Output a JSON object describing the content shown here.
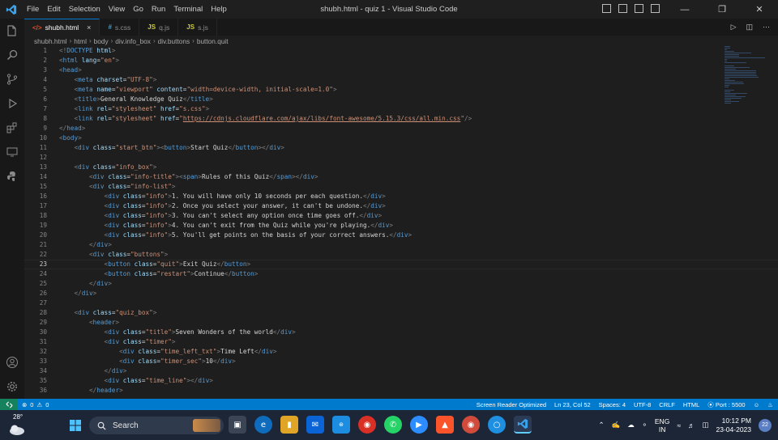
{
  "menu": [
    "File",
    "Edit",
    "Selection",
    "View",
    "Go",
    "Run",
    "Terminal",
    "Help"
  ],
  "window_title": "shubh.html - quiz 1 - Visual Studio Code",
  "tabs": [
    {
      "icon": "</>",
      "label": "shubh.html",
      "close": "×",
      "active": true,
      "icon_color": "#e44d26"
    },
    {
      "icon": "#",
      "label": "s.css",
      "active": false,
      "icon_color": "#519aba"
    },
    {
      "icon": "JS",
      "label": "q.js",
      "active": false,
      "icon_color": "#cbcb41"
    },
    {
      "icon": "JS",
      "label": "s.js",
      "active": false,
      "icon_color": "#cbcb41"
    }
  ],
  "breadcrumb": [
    "shubh.html",
    "html",
    "body",
    "div.info_box",
    "div.buttons",
    "button.quit"
  ],
  "line_numbers": [
    "1",
    "2",
    "3",
    "4",
    "5",
    "6",
    "7",
    "8",
    "9",
    "10",
    "11",
    "12",
    "13",
    "14",
    "15",
    "16",
    "17",
    "18",
    "19",
    "20",
    "21",
    "22",
    "23",
    "24",
    "25",
    "26",
    "27",
    "28",
    "29",
    "30",
    "31",
    "32",
    "33",
    "34",
    "35",
    "36"
  ],
  "current_line": 23,
  "code": [
    [
      [
        "br",
        "<!"
      ],
      [
        "tg",
        "DOCTYPE"
      ],
      [
        "at",
        " html"
      ],
      [
        "br",
        ">"
      ]
    ],
    [
      [
        "br",
        "<"
      ],
      [
        "tg",
        "html"
      ],
      [
        "at",
        " lang"
      ],
      [
        "t",
        "="
      ],
      [
        "st",
        "\"en\""
      ],
      [
        "br",
        ">"
      ]
    ],
    [
      [
        "br",
        "<"
      ],
      [
        "tg",
        "head"
      ],
      [
        "br",
        ">"
      ]
    ],
    [
      [
        "t",
        "    "
      ],
      [
        "br",
        "<"
      ],
      [
        "tg",
        "meta"
      ],
      [
        "at",
        " charset"
      ],
      [
        "t",
        "="
      ],
      [
        "st",
        "\"UTF-8\""
      ],
      [
        "br",
        ">"
      ]
    ],
    [
      [
        "t",
        "    "
      ],
      [
        "br",
        "<"
      ],
      [
        "tg",
        "meta"
      ],
      [
        "at",
        " name"
      ],
      [
        "t",
        "="
      ],
      [
        "st",
        "\"viewport\""
      ],
      [
        "at",
        " content"
      ],
      [
        "t",
        "="
      ],
      [
        "st",
        "\"width=device-width, initial-scale=1.0\""
      ],
      [
        "br",
        ">"
      ]
    ],
    [
      [
        "t",
        "    "
      ],
      [
        "br",
        "<"
      ],
      [
        "tg",
        "title"
      ],
      [
        "br",
        ">"
      ],
      [
        "t",
        "General Knowledge Quiz"
      ],
      [
        "br",
        "</"
      ],
      [
        "tg",
        "title"
      ],
      [
        "br",
        ">"
      ]
    ],
    [
      [
        "t",
        "    "
      ],
      [
        "br",
        "<"
      ],
      [
        "tg",
        "link"
      ],
      [
        "at",
        " rel"
      ],
      [
        "t",
        "="
      ],
      [
        "st",
        "\"stylesheet\""
      ],
      [
        "at",
        " href"
      ],
      [
        "t",
        "="
      ],
      [
        "st",
        "\"s.css\""
      ],
      [
        "br",
        ">"
      ]
    ],
    [
      [
        "t",
        "    "
      ],
      [
        "br",
        "<"
      ],
      [
        "tg",
        "link"
      ],
      [
        "at",
        " rel"
      ],
      [
        "t",
        "="
      ],
      [
        "st",
        "\"stylesheet\""
      ],
      [
        "at",
        " href"
      ],
      [
        "t",
        "="
      ],
      [
        "st",
        "\""
      ],
      [
        "lk",
        "https://cdnjs.cloudflare.com/ajax/libs/font-awesome/5.15.3/css/all.min.css"
      ],
      [
        "st",
        "\""
      ],
      [
        "br",
        "/>"
      ]
    ],
    [
      [
        "br",
        "</"
      ],
      [
        "tg",
        "head"
      ],
      [
        "br",
        ">"
      ]
    ],
    [
      [
        "br",
        "<"
      ],
      [
        "tg",
        "body"
      ],
      [
        "br",
        ">"
      ]
    ],
    [
      [
        "t",
        "    "
      ],
      [
        "br",
        "<"
      ],
      [
        "tg",
        "div"
      ],
      [
        "at",
        " class"
      ],
      [
        "t",
        "="
      ],
      [
        "st",
        "\"start_btn\""
      ],
      [
        "br",
        "><"
      ],
      [
        "tg",
        "button"
      ],
      [
        "br",
        ">"
      ],
      [
        "t",
        "Start Quiz"
      ],
      [
        "br",
        "</"
      ],
      [
        "tg",
        "button"
      ],
      [
        "br",
        "></"
      ],
      [
        "tg",
        "div"
      ],
      [
        "br",
        ">"
      ]
    ],
    [],
    [
      [
        "t",
        "    "
      ],
      [
        "br",
        "<"
      ],
      [
        "tg",
        "div"
      ],
      [
        "at",
        " class"
      ],
      [
        "t",
        "="
      ],
      [
        "st",
        "\"info_box\""
      ],
      [
        "br",
        ">"
      ]
    ],
    [
      [
        "t",
        "        "
      ],
      [
        "br",
        "<"
      ],
      [
        "tg",
        "div"
      ],
      [
        "at",
        " class"
      ],
      [
        "t",
        "="
      ],
      [
        "st",
        "\"info-title\""
      ],
      [
        "br",
        "><"
      ],
      [
        "tg",
        "span"
      ],
      [
        "br",
        ">"
      ],
      [
        "t",
        "Rules of this Quiz"
      ],
      [
        "br",
        "</"
      ],
      [
        "tg",
        "span"
      ],
      [
        "br",
        "></"
      ],
      [
        "tg",
        "div"
      ],
      [
        "br",
        ">"
      ]
    ],
    [
      [
        "t",
        "        "
      ],
      [
        "br",
        "<"
      ],
      [
        "tg",
        "div"
      ],
      [
        "at",
        " class"
      ],
      [
        "t",
        "="
      ],
      [
        "st",
        "\"info-list\""
      ],
      [
        "br",
        ">"
      ]
    ],
    [
      [
        "t",
        "            "
      ],
      [
        "br",
        "<"
      ],
      [
        "tg",
        "div"
      ],
      [
        "at",
        " class"
      ],
      [
        "t",
        "="
      ],
      [
        "st",
        "\"info\""
      ],
      [
        "br",
        ">"
      ],
      [
        "t",
        "1. You will have only 10 seconds per each question."
      ],
      [
        "br",
        "</"
      ],
      [
        "tg",
        "div"
      ],
      [
        "br",
        ">"
      ]
    ],
    [
      [
        "t",
        "            "
      ],
      [
        "br",
        "<"
      ],
      [
        "tg",
        "div"
      ],
      [
        "at",
        " class"
      ],
      [
        "t",
        "="
      ],
      [
        "st",
        "\"info\""
      ],
      [
        "br",
        ">"
      ],
      [
        "t",
        "2. Once you select your answer, it can't be undone."
      ],
      [
        "br",
        "</"
      ],
      [
        "tg",
        "div"
      ],
      [
        "br",
        ">"
      ]
    ],
    [
      [
        "t",
        "            "
      ],
      [
        "br",
        "<"
      ],
      [
        "tg",
        "div"
      ],
      [
        "at",
        " class"
      ],
      [
        "t",
        "="
      ],
      [
        "st",
        "\"info\""
      ],
      [
        "br",
        ">"
      ],
      [
        "t",
        "3. You can't select any option once time goes off."
      ],
      [
        "br",
        "</"
      ],
      [
        "tg",
        "div"
      ],
      [
        "br",
        ">"
      ]
    ],
    [
      [
        "t",
        "            "
      ],
      [
        "br",
        "<"
      ],
      [
        "tg",
        "div"
      ],
      [
        "at",
        " class"
      ],
      [
        "t",
        "="
      ],
      [
        "st",
        "\"info\""
      ],
      [
        "br",
        ">"
      ],
      [
        "t",
        "4. You can't exit from the Quiz while you're playing."
      ],
      [
        "br",
        "</"
      ],
      [
        "tg",
        "div"
      ],
      [
        "br",
        ">"
      ]
    ],
    [
      [
        "t",
        "            "
      ],
      [
        "br",
        "<"
      ],
      [
        "tg",
        "div"
      ],
      [
        "at",
        " class"
      ],
      [
        "t",
        "="
      ],
      [
        "st",
        "\"info\""
      ],
      [
        "br",
        ">"
      ],
      [
        "t",
        "5. You'll get points on the basis of your correct answers."
      ],
      [
        "br",
        "</"
      ],
      [
        "tg",
        "div"
      ],
      [
        "br",
        ">"
      ]
    ],
    [
      [
        "t",
        "        "
      ],
      [
        "br",
        "</"
      ],
      [
        "tg",
        "div"
      ],
      [
        "br",
        ">"
      ]
    ],
    [
      [
        "t",
        "        "
      ],
      [
        "br",
        "<"
      ],
      [
        "tg",
        "div"
      ],
      [
        "at",
        " class"
      ],
      [
        "t",
        "="
      ],
      [
        "st",
        "\"buttons\""
      ],
      [
        "br",
        ">"
      ]
    ],
    [
      [
        "t",
        "            "
      ],
      [
        "br",
        "<"
      ],
      [
        "tg",
        "button"
      ],
      [
        "at",
        " class"
      ],
      [
        "t",
        "="
      ],
      [
        "st",
        "\"quit\""
      ],
      [
        "br",
        ">"
      ],
      [
        "t",
        "Exit Quiz"
      ],
      [
        "br",
        "</"
      ],
      [
        "tg",
        "button"
      ],
      [
        "br",
        ">"
      ]
    ],
    [
      [
        "t",
        "            "
      ],
      [
        "br",
        "<"
      ],
      [
        "tg",
        "button"
      ],
      [
        "at",
        " class"
      ],
      [
        "t",
        "="
      ],
      [
        "st",
        "\"restart\""
      ],
      [
        "br",
        ">"
      ],
      [
        "t",
        "Continue"
      ],
      [
        "br",
        "</"
      ],
      [
        "tg",
        "button"
      ],
      [
        "br",
        ">"
      ]
    ],
    [
      [
        "t",
        "        "
      ],
      [
        "br",
        "</"
      ],
      [
        "tg",
        "div"
      ],
      [
        "br",
        ">"
      ]
    ],
    [
      [
        "t",
        "    "
      ],
      [
        "br",
        "</"
      ],
      [
        "tg",
        "div"
      ],
      [
        "br",
        ">"
      ]
    ],
    [],
    [
      [
        "t",
        "    "
      ],
      [
        "br",
        "<"
      ],
      [
        "tg",
        "div"
      ],
      [
        "at",
        " class"
      ],
      [
        "t",
        "="
      ],
      [
        "st",
        "\"quiz_box\""
      ],
      [
        "br",
        ">"
      ]
    ],
    [
      [
        "t",
        "        "
      ],
      [
        "br",
        "<"
      ],
      [
        "tg",
        "header"
      ],
      [
        "br",
        ">"
      ]
    ],
    [
      [
        "t",
        "            "
      ],
      [
        "br",
        "<"
      ],
      [
        "tg",
        "div"
      ],
      [
        "at",
        " class"
      ],
      [
        "t",
        "="
      ],
      [
        "st",
        "\"title\""
      ],
      [
        "br",
        ">"
      ],
      [
        "t",
        "Seven Wonders of the world"
      ],
      [
        "br",
        "</"
      ],
      [
        "tg",
        "div"
      ],
      [
        "br",
        ">"
      ]
    ],
    [
      [
        "t",
        "            "
      ],
      [
        "br",
        "<"
      ],
      [
        "tg",
        "div"
      ],
      [
        "at",
        " class"
      ],
      [
        "t",
        "="
      ],
      [
        "st",
        "\"timer\""
      ],
      [
        "br",
        ">"
      ]
    ],
    [
      [
        "t",
        "                "
      ],
      [
        "br",
        "<"
      ],
      [
        "tg",
        "div"
      ],
      [
        "at",
        " class"
      ],
      [
        "t",
        "="
      ],
      [
        "st",
        "\"time_left_txt\""
      ],
      [
        "br",
        ">"
      ],
      [
        "t",
        "Time Left"
      ],
      [
        "br",
        "</"
      ],
      [
        "tg",
        "div"
      ],
      [
        "br",
        ">"
      ]
    ],
    [
      [
        "t",
        "                "
      ],
      [
        "br",
        "<"
      ],
      [
        "tg",
        "div"
      ],
      [
        "at",
        " class"
      ],
      [
        "t",
        "="
      ],
      [
        "st",
        "\"timer_sec\""
      ],
      [
        "br",
        ">"
      ],
      [
        "t",
        "10"
      ],
      [
        "br",
        "</"
      ],
      [
        "tg",
        "div"
      ],
      [
        "br",
        ">"
      ]
    ],
    [
      [
        "t",
        "            "
      ],
      [
        "br",
        "</"
      ],
      [
        "tg",
        "div"
      ],
      [
        "br",
        ">"
      ]
    ],
    [
      [
        "t",
        "            "
      ],
      [
        "br",
        "<"
      ],
      [
        "tg",
        "div"
      ],
      [
        "at",
        " class"
      ],
      [
        "t",
        "="
      ],
      [
        "st",
        "\"time_line\""
      ],
      [
        "br",
        "></"
      ],
      [
        "tg",
        "div"
      ],
      [
        "br",
        ">"
      ]
    ],
    [
      [
        "t",
        "        "
      ],
      [
        "br",
        "</"
      ],
      [
        "tg",
        "header"
      ],
      [
        "br",
        ">"
      ]
    ]
  ],
  "status": {
    "errors": "0",
    "warnings": "0",
    "screen_reader": "Screen Reader Optimized",
    "cursor": "Ln 23, Col 52",
    "spaces": "Spaces: 4",
    "encoding": "UTF-8",
    "eol": "CRLF",
    "language": "HTML",
    "port": "Port : 5500"
  },
  "taskbar": {
    "temperature": "28°",
    "search_placeholder": "Search",
    "lang_line1": "ENG",
    "lang_line2": "IN",
    "time": "10:12 PM",
    "date": "23-04-2023",
    "notifications": "22"
  },
  "colors": {
    "accent": "#007acc",
    "remote": "#16825d",
    "editor_bg": "#1e1e1e",
    "tag": "#569cd6",
    "attribute": "#9cdcfe",
    "string": "#ce9178"
  }
}
